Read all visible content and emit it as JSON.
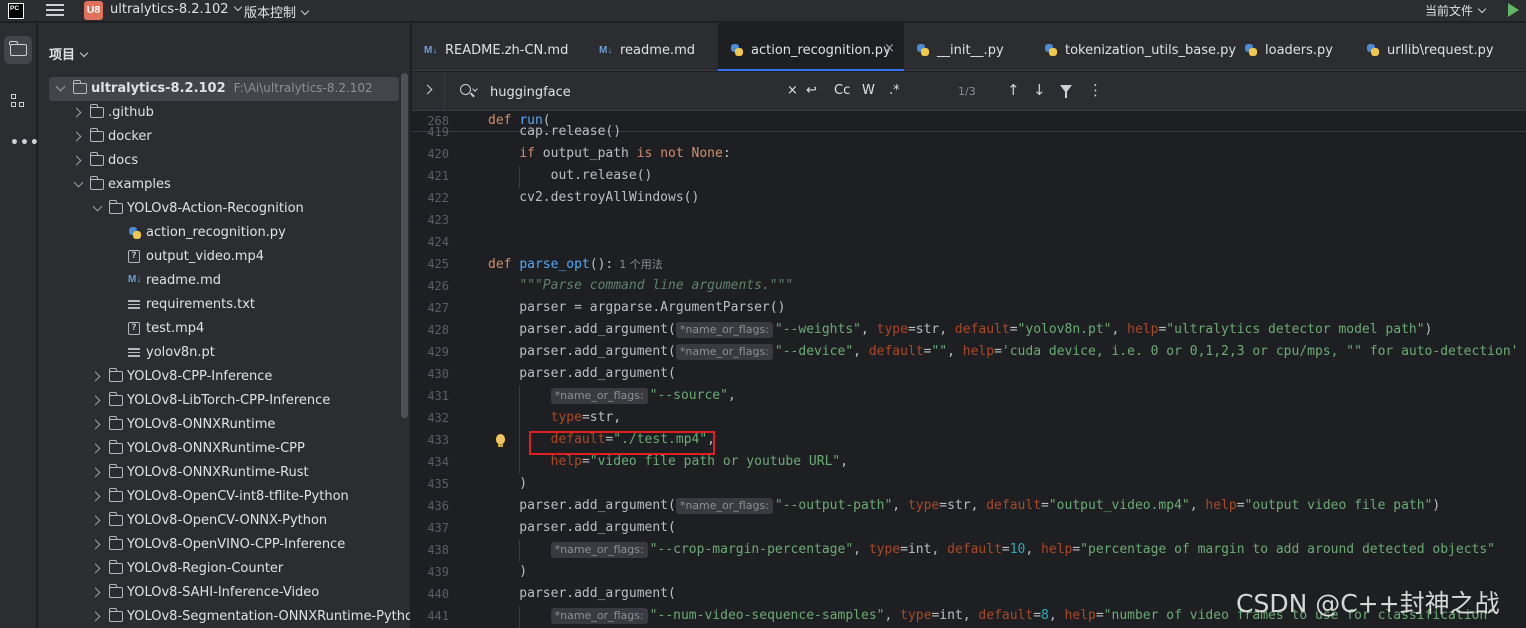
{
  "titlebar": {
    "logo_text": "PC",
    "project_badge": "U8",
    "project_name": "ultralytics-8.2.102",
    "vcs_label": "版本控制",
    "run_config": "当前文件"
  },
  "project_panel": {
    "header": "项目",
    "root": {
      "name": "ultralytics-8.2.102",
      "path": "F:\\Ai\\ultralytics-8.2.102"
    },
    "items": [
      {
        "name": ".github",
        "type": "folder",
        "depth": 1,
        "expanded": false
      },
      {
        "name": "docker",
        "type": "folder",
        "depth": 1,
        "expanded": false
      },
      {
        "name": "docs",
        "type": "folder",
        "depth": 1,
        "expanded": false
      },
      {
        "name": "examples",
        "type": "folder",
        "depth": 1,
        "expanded": true
      },
      {
        "name": "YOLOv8-Action-Recognition",
        "type": "folder",
        "depth": 2,
        "expanded": true
      },
      {
        "name": "action_recognition.py",
        "type": "py",
        "depth": 3
      },
      {
        "name": "output_video.mp4",
        "type": "unknown",
        "depth": 3
      },
      {
        "name": "readme.md",
        "type": "md",
        "depth": 3
      },
      {
        "name": "requirements.txt",
        "type": "txt",
        "depth": 3
      },
      {
        "name": "test.mp4",
        "type": "unknown",
        "depth": 3
      },
      {
        "name": "yolov8n.pt",
        "type": "pt",
        "depth": 3
      },
      {
        "name": "YOLOv8-CPP-Inference",
        "type": "folder",
        "depth": 2,
        "expanded": false
      },
      {
        "name": "YOLOv8-LibTorch-CPP-Inference",
        "type": "folder",
        "depth": 2,
        "expanded": false
      },
      {
        "name": "YOLOv8-ONNXRuntime",
        "type": "folder",
        "depth": 2,
        "expanded": false
      },
      {
        "name": "YOLOv8-ONNXRuntime-CPP",
        "type": "folder",
        "depth": 2,
        "expanded": false
      },
      {
        "name": "YOLOv8-ONNXRuntime-Rust",
        "type": "folder",
        "depth": 2,
        "expanded": false
      },
      {
        "name": "YOLOv8-OpenCV-int8-tflite-Python",
        "type": "folder",
        "depth": 2,
        "expanded": false
      },
      {
        "name": "YOLOv8-OpenCV-ONNX-Python",
        "type": "folder",
        "depth": 2,
        "expanded": false
      },
      {
        "name": "YOLOv8-OpenVINO-CPP-Inference",
        "type": "folder",
        "depth": 2,
        "expanded": false
      },
      {
        "name": "YOLOv8-Region-Counter",
        "type": "folder",
        "depth": 2,
        "expanded": false
      },
      {
        "name": "YOLOv8-SAHI-Inference-Video",
        "type": "folder",
        "depth": 2,
        "expanded": false
      },
      {
        "name": "YOLOv8-Segmentation-ONNXRuntime-Python",
        "type": "folder",
        "depth": 2,
        "expanded": false
      }
    ]
  },
  "tabs": [
    {
      "label": "README.zh-CN.md",
      "icon": "md",
      "active": false
    },
    {
      "label": "readme.md",
      "icon": "md",
      "active": false
    },
    {
      "label": "action_recognition.py",
      "icon": "py",
      "active": true
    },
    {
      "label": "__init__.py",
      "icon": "py",
      "active": false
    },
    {
      "label": "tokenization_utils_base.py",
      "icon": "py",
      "active": false
    },
    {
      "label": "loaders.py",
      "icon": "py",
      "active": false
    },
    {
      "label": "urllib\\request.py",
      "icon": "py",
      "active": false
    }
  ],
  "find": {
    "query": "huggingface",
    "count": "1/3",
    "case_label": "Cc",
    "word_label": "W",
    "regex_label": ".*"
  },
  "code": {
    "sticky": {
      "line": "268",
      "text": "def run("
    },
    "lines": [
      {
        "n": "419",
        "tokens": [
          [
            "p",
            "    cap.release()"
          ]
        ]
      },
      {
        "n": "420",
        "tokens": [
          [
            "p",
            "    "
          ],
          [
            "kw",
            "if"
          ],
          [
            "p",
            " output_path "
          ],
          [
            "kw",
            "is not None"
          ],
          [
            "p",
            ":"
          ]
        ]
      },
      {
        "n": "421",
        "tokens": [
          [
            "p",
            "        out.release()"
          ]
        ]
      },
      {
        "n": "422",
        "tokens": [
          [
            "p",
            "    cv2.destroyAllWindows()"
          ]
        ]
      },
      {
        "n": "423",
        "tokens": []
      },
      {
        "n": "424",
        "tokens": []
      },
      {
        "n": "425",
        "tokens": [
          [
            "kw",
            "def "
          ],
          [
            "fn",
            "parse_opt"
          ],
          [
            "p",
            "():"
          ],
          [
            "usage",
            "1 个用法"
          ]
        ]
      },
      {
        "n": "426",
        "tokens": [
          [
            "p",
            "    "
          ],
          [
            "doc",
            "\"\"\"Parse command line arguments.\"\"\""
          ]
        ]
      },
      {
        "n": "427",
        "tokens": [
          [
            "p",
            "    parser = argparse.ArgumentParser()"
          ]
        ]
      },
      {
        "n": "428",
        "tokens": [
          [
            "p",
            "    parser.add_argument("
          ],
          [
            "hint",
            "*name_or_flags:"
          ],
          [
            "str",
            "\"--weights\""
          ],
          [
            "p",
            ", "
          ],
          [
            "param",
            "type"
          ],
          [
            "p",
            "=str, "
          ],
          [
            "param",
            "default"
          ],
          [
            "p",
            "="
          ],
          [
            "str",
            "\"yolov8n.pt\""
          ],
          [
            "p",
            ", "
          ],
          [
            "param",
            "help"
          ],
          [
            "p",
            "="
          ],
          [
            "str",
            "\"ultralytics detector model path\""
          ],
          [
            "p",
            ")"
          ]
        ]
      },
      {
        "n": "429",
        "tokens": [
          [
            "p",
            "    parser.add_argument("
          ],
          [
            "hint",
            "*name_or_flags:"
          ],
          [
            "str",
            "\"--device\""
          ],
          [
            "p",
            ", "
          ],
          [
            "param",
            "default"
          ],
          [
            "p",
            "="
          ],
          [
            "str",
            "\"\""
          ],
          [
            "p",
            ", "
          ],
          [
            "param",
            "help"
          ],
          [
            "p",
            "="
          ],
          [
            "str",
            "'cuda device, i.e. 0 or 0,1,2,3 or cpu/mps, \"\" for auto-detection'"
          ]
        ]
      },
      {
        "n": "430",
        "tokens": [
          [
            "p",
            "    parser.add_argument("
          ]
        ]
      },
      {
        "n": "431",
        "tokens": [
          [
            "p",
            "        "
          ],
          [
            "hint",
            "*name_or_flags:"
          ],
          [
            "str",
            "\"--source\""
          ],
          [
            "p",
            ","
          ]
        ]
      },
      {
        "n": "432",
        "tokens": [
          [
            "p",
            "        "
          ],
          [
            "param",
            "type"
          ],
          [
            "p",
            "=str,"
          ]
        ]
      },
      {
        "n": "433",
        "tokens": [
          [
            "p",
            "        "
          ],
          [
            "param",
            "default"
          ],
          [
            "p",
            "="
          ],
          [
            "str",
            "\"./test.mp4\""
          ],
          [
            "p",
            ","
          ]
        ]
      },
      {
        "n": "434",
        "tokens": [
          [
            "p",
            "        "
          ],
          [
            "param",
            "help"
          ],
          [
            "p",
            "="
          ],
          [
            "str",
            "\"video file path or youtube URL\""
          ],
          [
            "p",
            ","
          ]
        ]
      },
      {
        "n": "435",
        "tokens": [
          [
            "p",
            "    )"
          ]
        ]
      },
      {
        "n": "436",
        "tokens": [
          [
            "p",
            "    parser.add_argument("
          ],
          [
            "hint",
            "*name_or_flags:"
          ],
          [
            "str",
            "\"--output-path\""
          ],
          [
            "p",
            ", "
          ],
          [
            "param",
            "type"
          ],
          [
            "p",
            "=str, "
          ],
          [
            "param",
            "default"
          ],
          [
            "p",
            "="
          ],
          [
            "str",
            "\"output_video.mp4\""
          ],
          [
            "p",
            ", "
          ],
          [
            "param",
            "help"
          ],
          [
            "p",
            "="
          ],
          [
            "str",
            "\"output video file path\""
          ],
          [
            "p",
            ")"
          ]
        ]
      },
      {
        "n": "437",
        "tokens": [
          [
            "p",
            "    parser.add_argument("
          ]
        ]
      },
      {
        "n": "438",
        "tokens": [
          [
            "p",
            "        "
          ],
          [
            "hint",
            "*name_or_flags:"
          ],
          [
            "str",
            "\"--crop-margin-percentage\""
          ],
          [
            "p",
            ", "
          ],
          [
            "param",
            "type"
          ],
          [
            "p",
            "=int, "
          ],
          [
            "param",
            "default"
          ],
          [
            "p",
            "="
          ],
          [
            "num",
            "10"
          ],
          [
            "p",
            ", "
          ],
          [
            "param",
            "help"
          ],
          [
            "p",
            "="
          ],
          [
            "str",
            "\"percentage of margin to add around detected objects\""
          ]
        ]
      },
      {
        "n": "439",
        "tokens": [
          [
            "p",
            "    )"
          ]
        ]
      },
      {
        "n": "440",
        "tokens": [
          [
            "p",
            "    parser.add_argument("
          ]
        ]
      },
      {
        "n": "441",
        "tokens": [
          [
            "p",
            "        "
          ],
          [
            "hint",
            "*name_or_flags:"
          ],
          [
            "str",
            "\"--num-video-sequence-samples\""
          ],
          [
            "p",
            ", "
          ],
          [
            "param",
            "type"
          ],
          [
            "p",
            "=int, "
          ],
          [
            "param",
            "default"
          ],
          [
            "p",
            "="
          ],
          [
            "num",
            "8"
          ],
          [
            "p",
            ", "
          ],
          [
            "param",
            "help"
          ],
          [
            "p",
            "="
          ],
          [
            "str",
            "\"number of video frames to use for classification\""
          ]
        ]
      }
    ]
  },
  "watermark": "CSDN @C++封神之战",
  "colors": {
    "background": "#1e1f22",
    "panel": "#2b2d30",
    "accent": "#3574f0",
    "keyword": "#cf8e6d",
    "string": "#6aab73",
    "function": "#56a8f5",
    "highlight_box": "#e02020"
  }
}
